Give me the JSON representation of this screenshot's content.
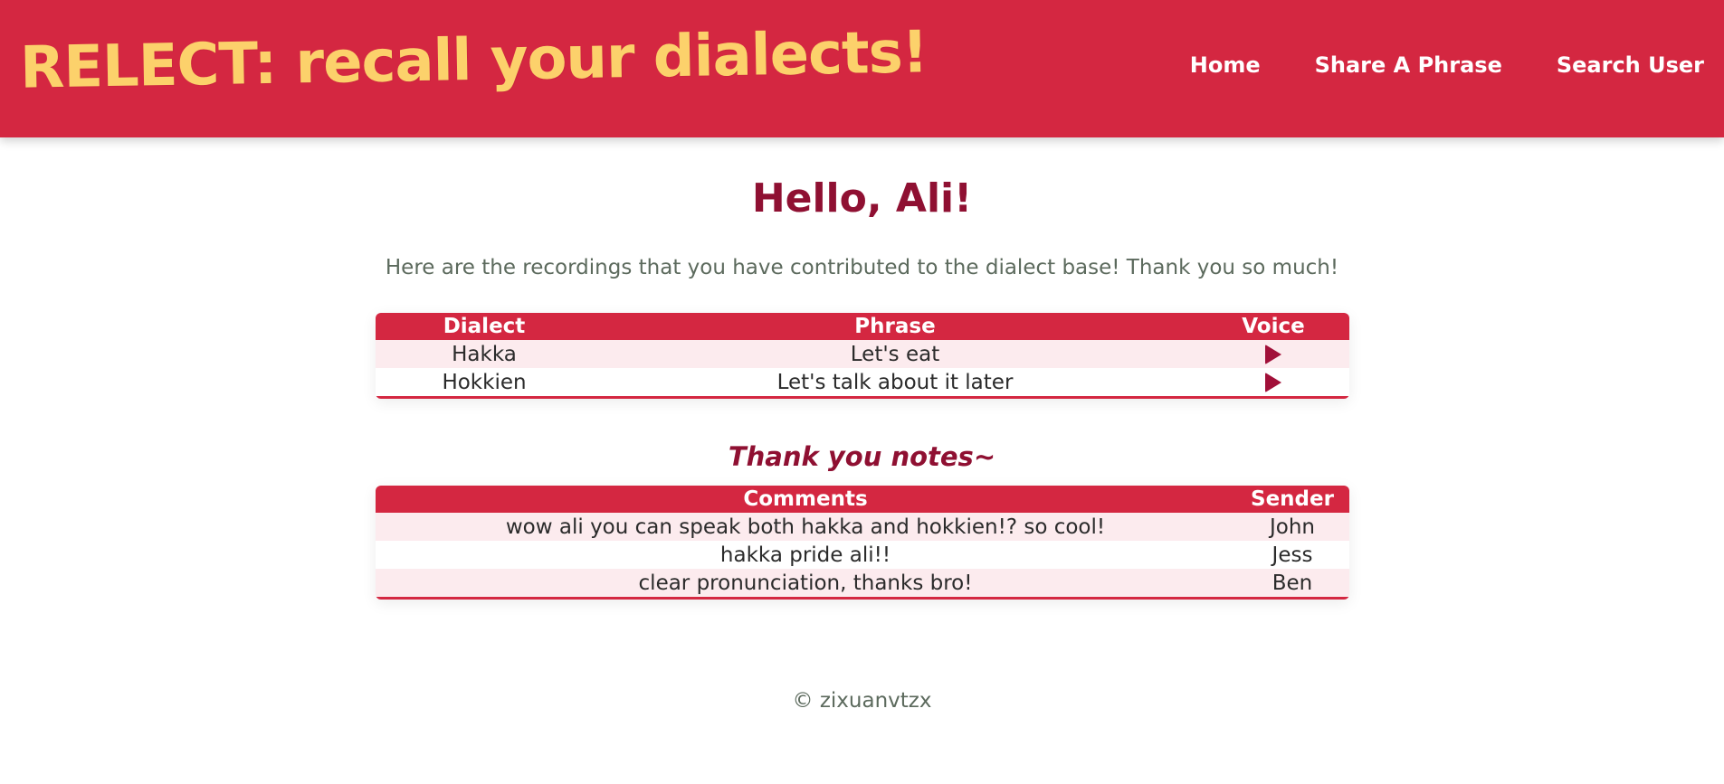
{
  "header": {
    "brand": "RELECT: recall your dialects!",
    "nav": [
      "Home",
      "Share A Phrase",
      "Search User"
    ]
  },
  "main": {
    "greeting": "Hello, Ali!",
    "intro": "Here are the recordings that you have contributed to the dialect base! Thank you so much!",
    "recordings": {
      "columns": [
        "Dialect",
        "Phrase",
        "Voice"
      ],
      "rows": [
        {
          "dialect": "Hakka",
          "phrase": "Let's eat",
          "voice_icon": "play-icon"
        },
        {
          "dialect": "Hokkien",
          "phrase": "Let's talk about it later",
          "voice_icon": "play-icon"
        }
      ]
    },
    "notes_title": "Thank you notes~",
    "notes": {
      "columns": [
        "Comments",
        "Sender"
      ],
      "rows": [
        {
          "comment": "wow ali you can speak both hakka and hokkien!? so cool!",
          "sender": "John"
        },
        {
          "comment": "hakka pride ali!!",
          "sender": "Jess"
        },
        {
          "comment": "clear pronunciation, thanks bro!",
          "sender": "Ben"
        }
      ]
    }
  },
  "footer": {
    "text": "© zixuanvtzx"
  },
  "colors": {
    "primary": "#d42741",
    "brand_text": "#fcd16b",
    "heading": "#8f1032",
    "row_alt": "#fcebee",
    "muted_text": "#5c6a5d"
  }
}
